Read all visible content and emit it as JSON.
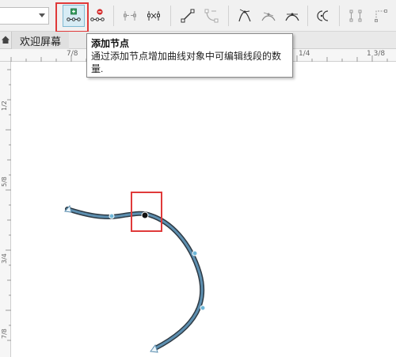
{
  "toolbar": {
    "dropdown_value": "",
    "buttons": [
      {
        "name": "add-node-button",
        "icon": "add-node-icon",
        "active": true
      },
      {
        "name": "delete-node-button",
        "icon": "delete-node-icon"
      },
      {
        "name": "join-nodes-button",
        "icon": "join-nodes-icon"
      },
      {
        "name": "break-curve-button",
        "icon": "break-curve-icon"
      },
      {
        "name": "to-line-button",
        "icon": "to-line-icon"
      },
      {
        "name": "to-curve-button",
        "icon": "to-curve-icon"
      },
      {
        "name": "cusp-node-button",
        "icon": "cusp-node-icon"
      },
      {
        "name": "smooth-node-button",
        "icon": "smooth-node-icon"
      },
      {
        "name": "symmetrical-node-button",
        "icon": "symmetrical-node-icon"
      },
      {
        "name": "reverse-direction-button",
        "icon": "reverse-direction-icon"
      },
      {
        "name": "extend-curve-button",
        "icon": "extend-curve-icon"
      },
      {
        "name": "close-curve-button",
        "icon": "close-curve-icon"
      }
    ],
    "accent": "#3a8fb7",
    "delete_color": "#d42a2a",
    "highlight_color": "#e03a3a"
  },
  "tabs": {
    "home_icon": "home-icon",
    "active_tab": "欢迎屏幕"
  },
  "ruler": {
    "h_labels": [
      "7/8",
      "1/4",
      "1 3/8"
    ],
    "v_labels": [
      "1/2",
      "5/8",
      "3/4",
      "7/8"
    ]
  },
  "tooltip": {
    "title": "添加节点",
    "description": "通过添加节点增加曲线对象中可编辑线段的数量."
  },
  "curve": {
    "stroke_color": "#2e3a44",
    "fill_color": "#5d8fb0",
    "node_color": "#6fb7d8",
    "selected_node_color": "#111111"
  }
}
